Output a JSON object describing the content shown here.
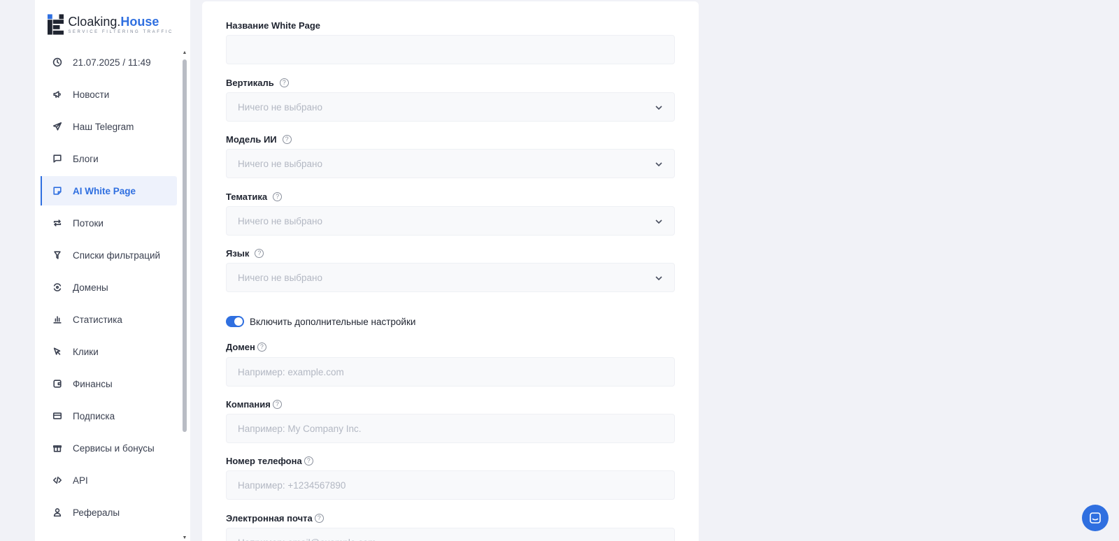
{
  "brand": {
    "name_main": "Cloaking.",
    "name_accent": "House",
    "tagline": "SERVICE FILTERING TRAFFIC"
  },
  "sidebar": {
    "items": [
      {
        "label": "21.07.2025 / 11:49",
        "icon": "clock-icon"
      },
      {
        "label": "Новости",
        "icon": "megaphone-icon"
      },
      {
        "label": "Наш Telegram",
        "icon": "paper-plane-icon"
      },
      {
        "label": "Блоги",
        "icon": "message-square-icon"
      },
      {
        "label": "AI White Page",
        "icon": "page-icon",
        "active": true
      },
      {
        "label": "Потоки",
        "icon": "repeat-icon"
      },
      {
        "label": "Списки фильтраций",
        "icon": "filter-icon"
      },
      {
        "label": "Домены",
        "icon": "domain-icon"
      },
      {
        "label": "Статистика",
        "icon": "bar-chart-icon"
      },
      {
        "label": "Клики",
        "icon": "cursor-icon"
      },
      {
        "label": "Финансы",
        "icon": "wallet-icon"
      },
      {
        "label": "Подписка",
        "icon": "credit-card-icon"
      },
      {
        "label": "Сервисы и бонусы",
        "icon": "gift-icon"
      },
      {
        "label": "API",
        "icon": "code-icon"
      },
      {
        "label": "Рефералы",
        "icon": "user-icon"
      }
    ]
  },
  "form": {
    "name": {
      "label": "Название White Page",
      "value": ""
    },
    "vertical": {
      "label": "Вертикаль",
      "value": "Ничего не выбрано"
    },
    "model": {
      "label": "Модель ИИ",
      "value": "Ничего не выбрано"
    },
    "topic": {
      "label": "Тематика",
      "value": "Ничего не выбрано"
    },
    "language": {
      "label": "Язык",
      "value": "Ничего не выбрано"
    },
    "advanced_toggle": {
      "label": "Включить дополнительные настройки",
      "on": true
    },
    "domain": {
      "label": "Домен",
      "placeholder": "Например: example.com"
    },
    "company": {
      "label": "Компания",
      "placeholder": "Например: My Company Inc."
    },
    "phone": {
      "label": "Номер телефона",
      "placeholder": "Например: +1234567890"
    },
    "email": {
      "label": "Электронная почта",
      "placeholder": "Например: email@example.com"
    }
  },
  "help_glyph": "?",
  "colors": {
    "accent": "#2f6fe0",
    "background": "#f1f2f7",
    "field": "#f8f9fb"
  }
}
